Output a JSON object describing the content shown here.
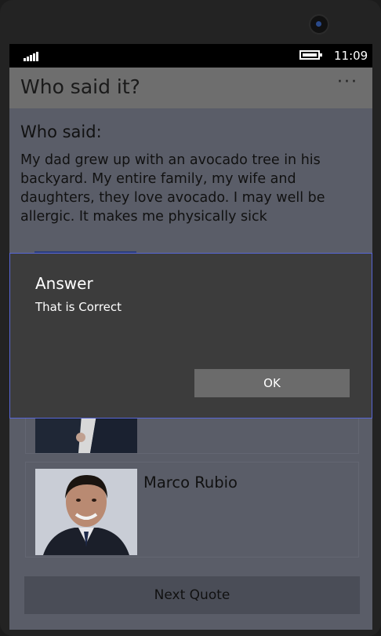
{
  "status": {
    "time": "11:09"
  },
  "app": {
    "title": "Who said it?",
    "more": "···"
  },
  "quiz": {
    "heading": "Who said:",
    "quote": "My dad grew up with an avocado tree in his backyard. My entire family, my wife and daughters, they love avocado. I may well be allergic. It makes me physically sick"
  },
  "candidates": [
    {
      "name": ""
    },
    {
      "name": "Marco Rubio"
    }
  ],
  "next_button": {
    "label": "Next Quote"
  },
  "dialog": {
    "title": "Answer",
    "message": "That is Correct",
    "ok_label": "OK"
  },
  "colors": {
    "screen_bg": "#5a5d68",
    "dialog_bg": "#3c3c3c",
    "dialog_border": "#5866d6",
    "button_bg": "#4a4d57"
  }
}
